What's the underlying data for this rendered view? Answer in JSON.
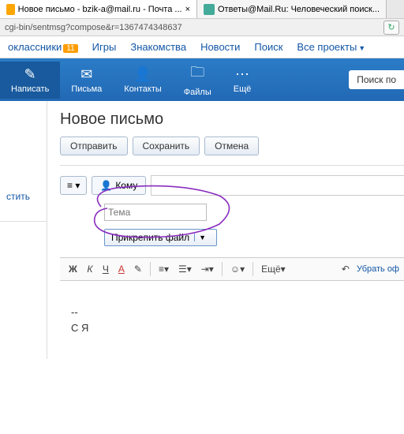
{
  "tabs": {
    "t1": "Новое письмо - bzik-a@mail.ru - Почта ...",
    "t2": "Ответы@Mail.Ru: Человеческий поиск..."
  },
  "address_bar": "cgi-bin/sentmsg?compose&r=1367474348637",
  "top_nav": {
    "item0": "оклассники",
    "badge0": "11",
    "item1": "Игры",
    "item2": "Знакомства",
    "item3": "Новости",
    "item4": "Поиск",
    "item5": "Все проекты"
  },
  "toolbar": {
    "write": "Написать",
    "letters": "Письма",
    "contacts": "Контакты",
    "files": "Файлы",
    "more": "Ещё",
    "search": "Поиск по"
  },
  "sidebar": {
    "clear": "стить"
  },
  "page": {
    "title": "Новое письмо",
    "send": "Отправить",
    "save": "Сохранить",
    "cancel": "Отмена",
    "priority": "≡ ▾",
    "to_label": "Кому",
    "subject_placeholder": "Тема",
    "attach": "Прикрепить файл"
  },
  "editor": {
    "bold": "Ж",
    "italic": "К",
    "underline": "Ч",
    "color": "А",
    "more": "Ещё",
    "remove_fmt": "Убрать оф"
  },
  "body": {
    "sig_sep": "--",
    "sig": "С Я"
  }
}
